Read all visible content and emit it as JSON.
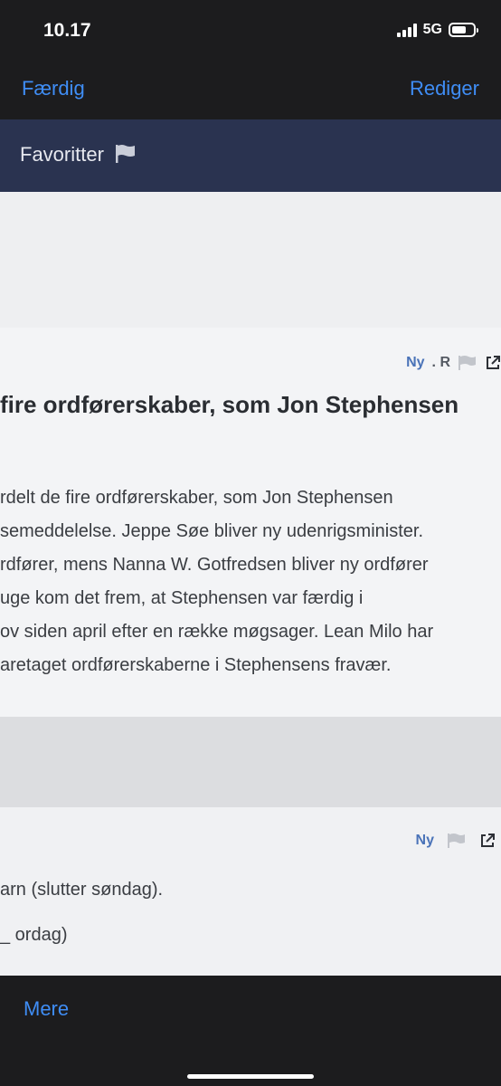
{
  "status_bar": {
    "time": "10.17",
    "network": "5G",
    "battery_level": 0.7
  },
  "nav": {
    "done_label": "Færdig",
    "edit_label": "Rediger"
  },
  "favorites": {
    "title": "Favoritter"
  },
  "article1": {
    "new_badge": "Ny",
    "read_mark": ". R",
    "headline": "fire ordførerskaber, som Jon Stephensen",
    "lines": [
      "rdelt de fire ordførerskaber, som Jon Stephensen",
      "semeddelelse. Jeppe Søe bliver ny udenrigsminister.",
      "rdfører, mens Nanna W. Gotfredsen bliver ny ordfører",
      " uge kom det frem, at Stephensen var færdig i",
      "ov siden april efter en række møgsager. Lean Milo har",
      "aretaget ordførerskaberne i Stephensens fravær."
    ]
  },
  "article2": {
    "new_badge": "Ny",
    "line1": "arn (slutter søndag).",
    "line2": "_ ordag)"
  },
  "toolbar": {
    "more_label": "Mere"
  },
  "colors": {
    "accent": "#3f8df5",
    "header_bg": "#2a3350",
    "badge_blue": "#4a73b8"
  }
}
